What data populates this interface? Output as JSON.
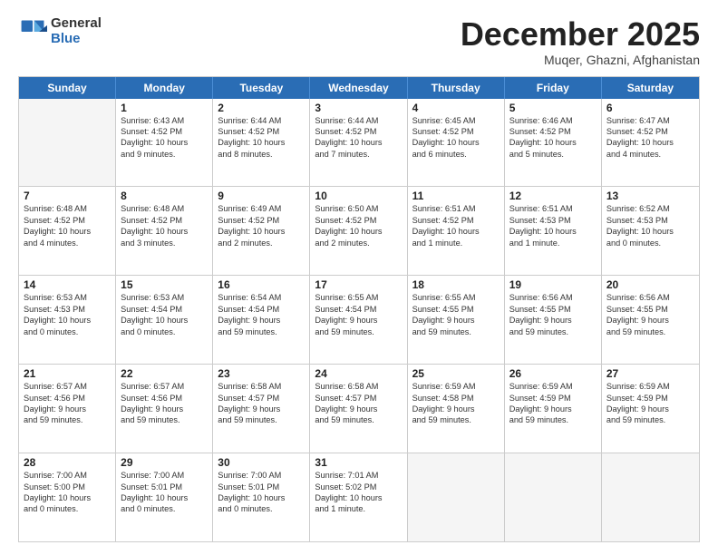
{
  "logo": {
    "general": "General",
    "blue": "Blue"
  },
  "title": "December 2025",
  "location": "Muqer, Ghazni, Afghanistan",
  "weekdays": [
    "Sunday",
    "Monday",
    "Tuesday",
    "Wednesday",
    "Thursday",
    "Friday",
    "Saturday"
  ],
  "weeks": [
    [
      {
        "day": "",
        "lines": []
      },
      {
        "day": "1",
        "lines": [
          "Sunrise: 6:43 AM",
          "Sunset: 4:52 PM",
          "Daylight: 10 hours",
          "and 9 minutes."
        ]
      },
      {
        "day": "2",
        "lines": [
          "Sunrise: 6:44 AM",
          "Sunset: 4:52 PM",
          "Daylight: 10 hours",
          "and 8 minutes."
        ]
      },
      {
        "day": "3",
        "lines": [
          "Sunrise: 6:44 AM",
          "Sunset: 4:52 PM",
          "Daylight: 10 hours",
          "and 7 minutes."
        ]
      },
      {
        "day": "4",
        "lines": [
          "Sunrise: 6:45 AM",
          "Sunset: 4:52 PM",
          "Daylight: 10 hours",
          "and 6 minutes."
        ]
      },
      {
        "day": "5",
        "lines": [
          "Sunrise: 6:46 AM",
          "Sunset: 4:52 PM",
          "Daylight: 10 hours",
          "and 5 minutes."
        ]
      },
      {
        "day": "6",
        "lines": [
          "Sunrise: 6:47 AM",
          "Sunset: 4:52 PM",
          "Daylight: 10 hours",
          "and 4 minutes."
        ]
      }
    ],
    [
      {
        "day": "7",
        "lines": [
          "Sunrise: 6:48 AM",
          "Sunset: 4:52 PM",
          "Daylight: 10 hours",
          "and 4 minutes."
        ]
      },
      {
        "day": "8",
        "lines": [
          "Sunrise: 6:48 AM",
          "Sunset: 4:52 PM",
          "Daylight: 10 hours",
          "and 3 minutes."
        ]
      },
      {
        "day": "9",
        "lines": [
          "Sunrise: 6:49 AM",
          "Sunset: 4:52 PM",
          "Daylight: 10 hours",
          "and 2 minutes."
        ]
      },
      {
        "day": "10",
        "lines": [
          "Sunrise: 6:50 AM",
          "Sunset: 4:52 PM",
          "Daylight: 10 hours",
          "and 2 minutes."
        ]
      },
      {
        "day": "11",
        "lines": [
          "Sunrise: 6:51 AM",
          "Sunset: 4:52 PM",
          "Daylight: 10 hours",
          "and 1 minute."
        ]
      },
      {
        "day": "12",
        "lines": [
          "Sunrise: 6:51 AM",
          "Sunset: 4:53 PM",
          "Daylight: 10 hours",
          "and 1 minute."
        ]
      },
      {
        "day": "13",
        "lines": [
          "Sunrise: 6:52 AM",
          "Sunset: 4:53 PM",
          "Daylight: 10 hours",
          "and 0 minutes."
        ]
      }
    ],
    [
      {
        "day": "14",
        "lines": [
          "Sunrise: 6:53 AM",
          "Sunset: 4:53 PM",
          "Daylight: 10 hours",
          "and 0 minutes."
        ]
      },
      {
        "day": "15",
        "lines": [
          "Sunrise: 6:53 AM",
          "Sunset: 4:54 PM",
          "Daylight: 10 hours",
          "and 0 minutes."
        ]
      },
      {
        "day": "16",
        "lines": [
          "Sunrise: 6:54 AM",
          "Sunset: 4:54 PM",
          "Daylight: 9 hours",
          "and 59 minutes."
        ]
      },
      {
        "day": "17",
        "lines": [
          "Sunrise: 6:55 AM",
          "Sunset: 4:54 PM",
          "Daylight: 9 hours",
          "and 59 minutes."
        ]
      },
      {
        "day": "18",
        "lines": [
          "Sunrise: 6:55 AM",
          "Sunset: 4:55 PM",
          "Daylight: 9 hours",
          "and 59 minutes."
        ]
      },
      {
        "day": "19",
        "lines": [
          "Sunrise: 6:56 AM",
          "Sunset: 4:55 PM",
          "Daylight: 9 hours",
          "and 59 minutes."
        ]
      },
      {
        "day": "20",
        "lines": [
          "Sunrise: 6:56 AM",
          "Sunset: 4:55 PM",
          "Daylight: 9 hours",
          "and 59 minutes."
        ]
      }
    ],
    [
      {
        "day": "21",
        "lines": [
          "Sunrise: 6:57 AM",
          "Sunset: 4:56 PM",
          "Daylight: 9 hours",
          "and 59 minutes."
        ]
      },
      {
        "day": "22",
        "lines": [
          "Sunrise: 6:57 AM",
          "Sunset: 4:56 PM",
          "Daylight: 9 hours",
          "and 59 minutes."
        ]
      },
      {
        "day": "23",
        "lines": [
          "Sunrise: 6:58 AM",
          "Sunset: 4:57 PM",
          "Daylight: 9 hours",
          "and 59 minutes."
        ]
      },
      {
        "day": "24",
        "lines": [
          "Sunrise: 6:58 AM",
          "Sunset: 4:57 PM",
          "Daylight: 9 hours",
          "and 59 minutes."
        ]
      },
      {
        "day": "25",
        "lines": [
          "Sunrise: 6:59 AM",
          "Sunset: 4:58 PM",
          "Daylight: 9 hours",
          "and 59 minutes."
        ]
      },
      {
        "day": "26",
        "lines": [
          "Sunrise: 6:59 AM",
          "Sunset: 4:59 PM",
          "Daylight: 9 hours",
          "and 59 minutes."
        ]
      },
      {
        "day": "27",
        "lines": [
          "Sunrise: 6:59 AM",
          "Sunset: 4:59 PM",
          "Daylight: 9 hours",
          "and 59 minutes."
        ]
      }
    ],
    [
      {
        "day": "28",
        "lines": [
          "Sunrise: 7:00 AM",
          "Sunset: 5:00 PM",
          "Daylight: 10 hours",
          "and 0 minutes."
        ]
      },
      {
        "day": "29",
        "lines": [
          "Sunrise: 7:00 AM",
          "Sunset: 5:01 PM",
          "Daylight: 10 hours",
          "and 0 minutes."
        ]
      },
      {
        "day": "30",
        "lines": [
          "Sunrise: 7:00 AM",
          "Sunset: 5:01 PM",
          "Daylight: 10 hours",
          "and 0 minutes."
        ]
      },
      {
        "day": "31",
        "lines": [
          "Sunrise: 7:01 AM",
          "Sunset: 5:02 PM",
          "Daylight: 10 hours",
          "and 1 minute."
        ]
      },
      {
        "day": "",
        "lines": []
      },
      {
        "day": "",
        "lines": []
      },
      {
        "day": "",
        "lines": []
      }
    ]
  ]
}
